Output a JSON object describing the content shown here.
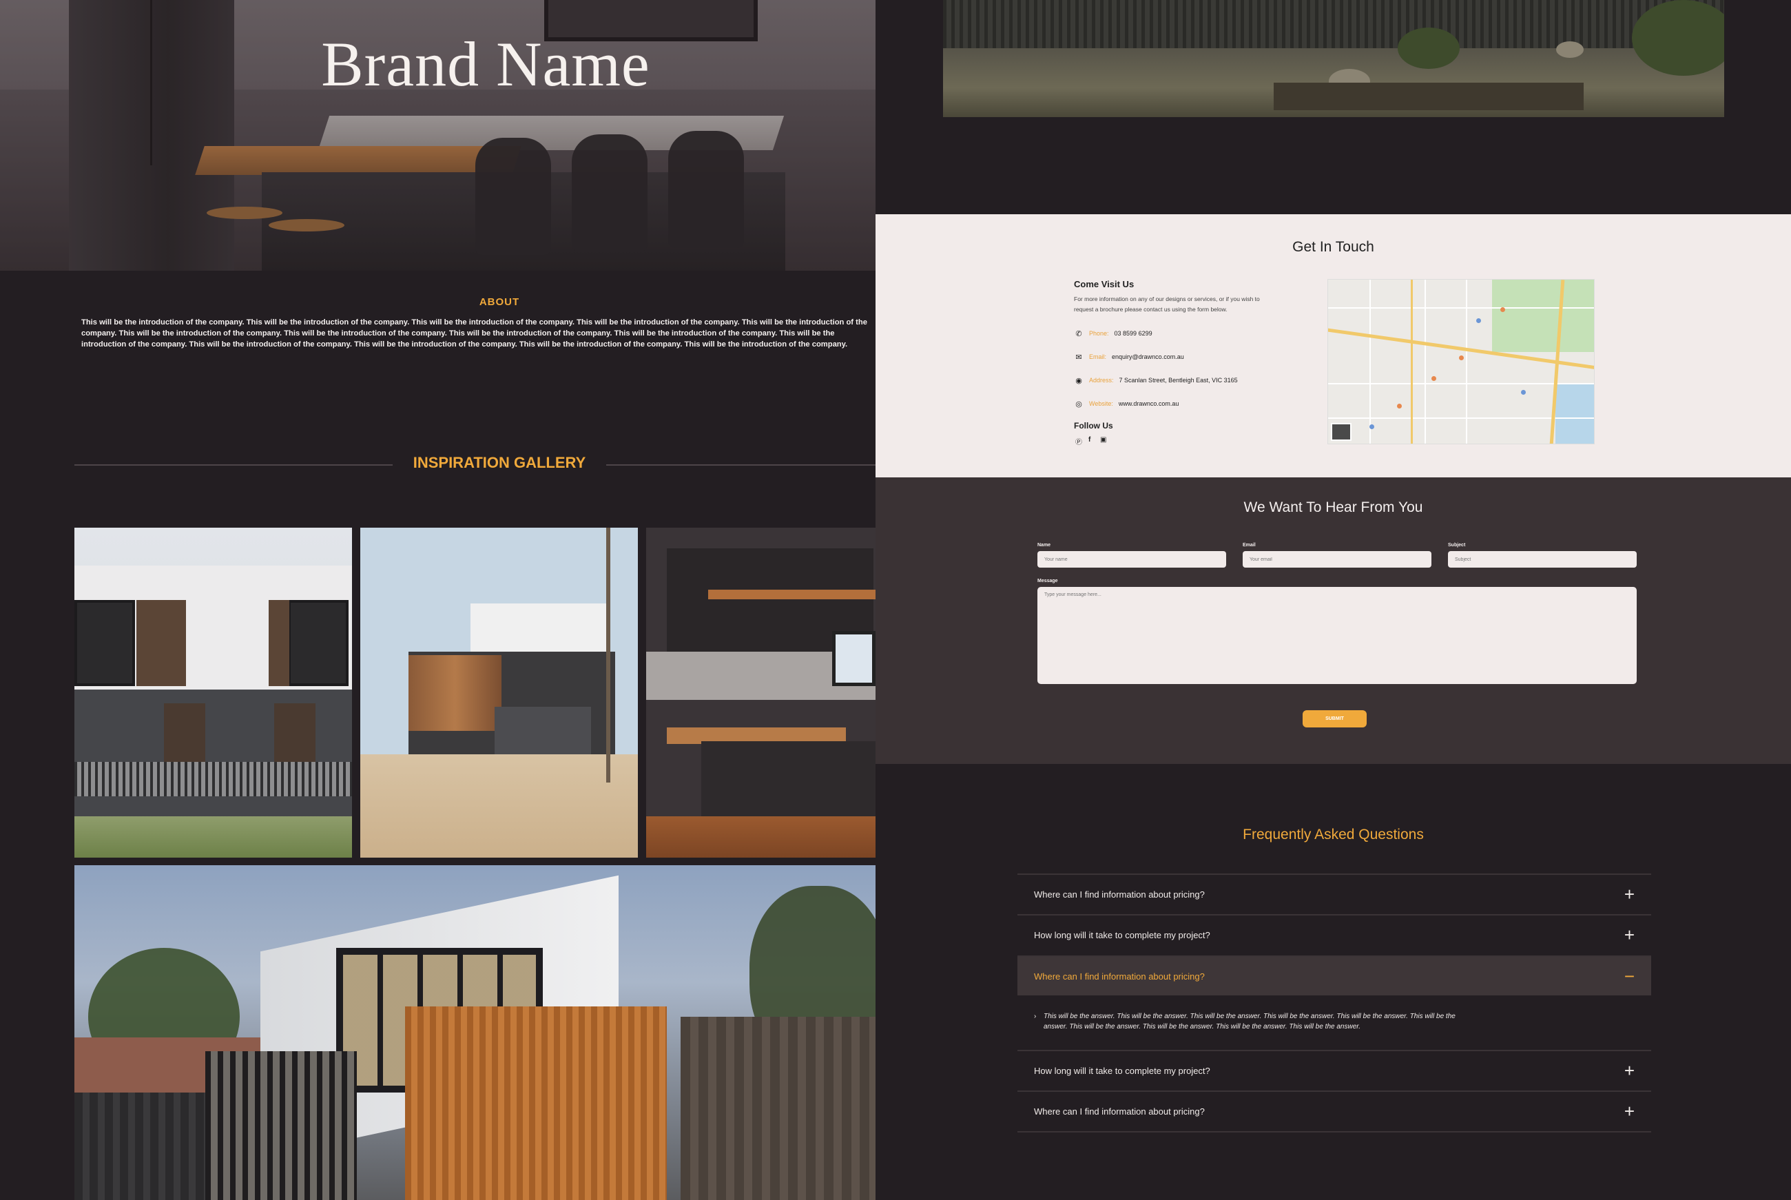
{
  "hero": {
    "brand": "Brand Name"
  },
  "about": {
    "title": "ABOUT",
    "text": "This will be the introduction of the company. This will be the introduction of the company. This will be the introduction of the company. This will be the introduction of the company. This will be the introduction of the company. This will be the introduction of the company. This will be the introduction of the company. This will be the introduction of the company. This will be the introduction of the company. This will be the introduction of the company. This will be the introduction of the company. This will be the introduction of the company. This will be the introduction of the company. This will be the introduction of the company."
  },
  "gallery": {
    "title": "INSPIRATION GALLERY"
  },
  "contact": {
    "title": "Get In Touch",
    "visit_title": "Come Visit Us",
    "visit_desc": "For more information on any of our designs or services, or if you wish to request a brochure please contact us using the form below.",
    "phone_label": "Phone:",
    "phone": "03 8599 6299",
    "email_label": "Email:",
    "email": "enquiry@drawnco.com.au",
    "address_label": "Address:",
    "address": "7 Scanlan Street, Bentleigh East, VIC 3165",
    "website_label": "Website:",
    "website": "www.drawnco.com.au",
    "follow_title": "Follow Us",
    "icons": {
      "phone": "phone-icon",
      "email": "mail-icon",
      "address": "location-pin-icon",
      "website": "globe-icon",
      "social": [
        "pinterest-icon",
        "facebook-icon",
        "instagram-icon"
      ]
    }
  },
  "form": {
    "title": "We Want To Hear From You",
    "name_label": "Name",
    "name_placeholder": "Your name",
    "email_label": "Email",
    "email_placeholder": "Your email",
    "subject_label": "Subject",
    "subject_placeholder": "Subject",
    "message_label": "Message",
    "message_placeholder": "Type your message here...",
    "submit_label": "SUBMIT"
  },
  "faq": {
    "title": "Frequently Asked Questions",
    "items": [
      {
        "question": "Where can I find information about pricing?",
        "toggle": "+"
      },
      {
        "question": "How long will it take to complete my project?",
        "toggle": "+"
      },
      {
        "question": "Where can I find information about pricing?",
        "toggle": "−"
      },
      {
        "question": "How long will it take to complete my project?",
        "toggle": "+"
      },
      {
        "question": "Where can I find information about pricing?",
        "toggle": "+"
      }
    ],
    "answer_marker": "›",
    "answer": "This will be the answer. This will be the answer. This will be the answer. This will be the answer. This will be the answer. This will be the answer. This will be the answer. This will be the answer. This will be the answer. This will be the answer."
  },
  "colors": {
    "accent": "#f0a93b",
    "background": "#231e22",
    "light_section": "#f2ebea",
    "form_section": "#3a3234"
  }
}
